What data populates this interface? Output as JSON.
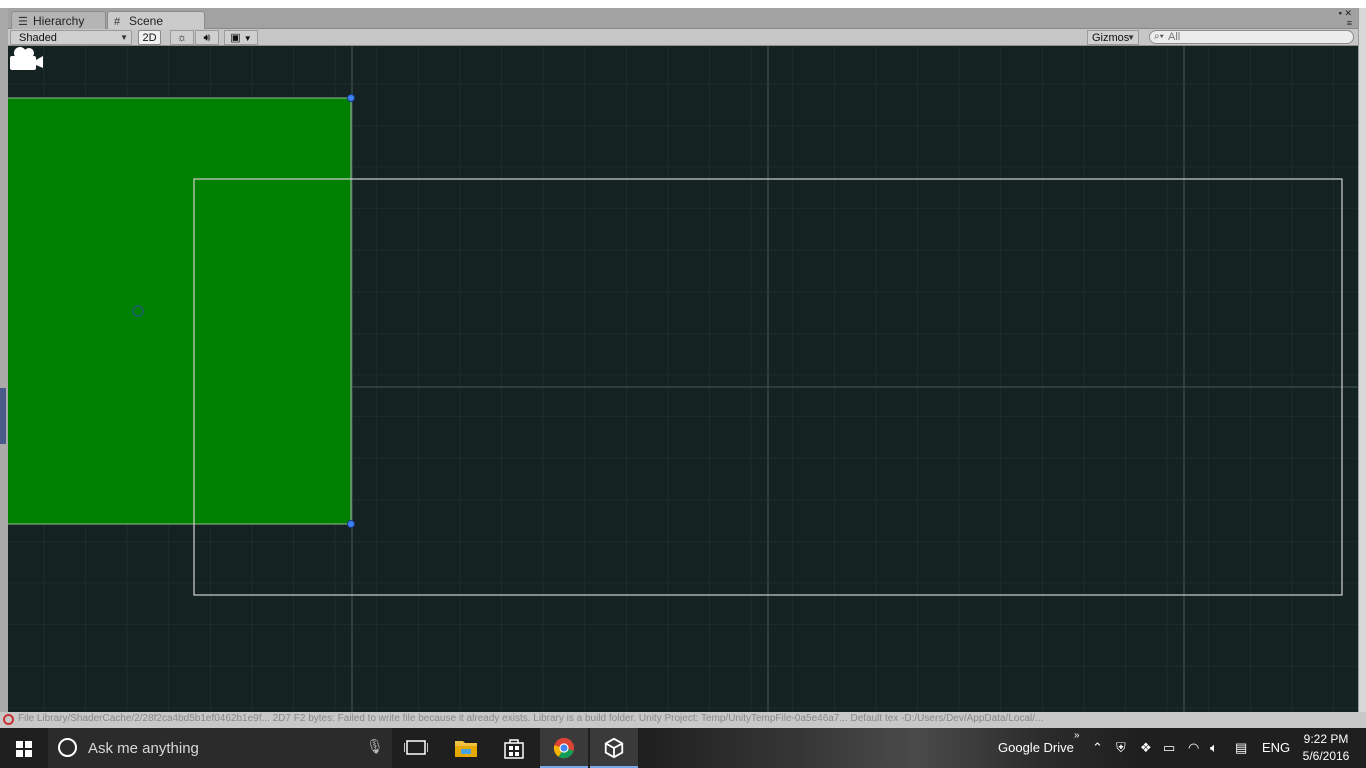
{
  "tabs": {
    "hierarchy": "Hierarchy",
    "scene": "Scene"
  },
  "toolbar": {
    "shading_mode": "Shaded",
    "mode_2d": "2D",
    "gizmos_label": "Gizmos",
    "search_placeholder": "All"
  },
  "scene": {
    "background_color": "#142321",
    "sprite_color": "#008000",
    "camera_frame_color": "#d0d0d0",
    "handle_color": "#3b82f6",
    "icon_names": [
      "camera-gizmo-icon",
      "pivot-circle-icon"
    ]
  },
  "console": {
    "message": "File Library/ShaderCache/2/28f2ca4bd5b1ef0462b1e9f... 2D7 F2 bytes: Failed to write file because it already exists. Library is a build folder. Unity Project: Temp/UnityTempFile-0a5e46a7... Default tex -D:/Users/Dev/AppData/Local/..."
  },
  "taskbar": {
    "search_placeholder": "Ask me anything",
    "tray_app": "Google Drive",
    "language": "ENG",
    "time": "9:22 PM",
    "date": "5/6/2016"
  }
}
